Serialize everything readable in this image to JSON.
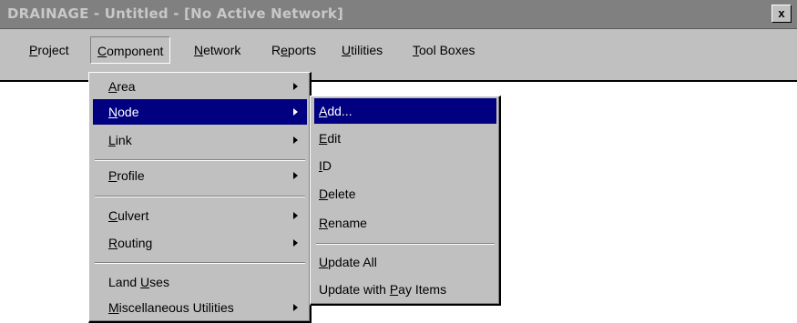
{
  "window": {
    "title": "DRAINAGE - Untitled - [No Active Network]",
    "close_glyph": "x"
  },
  "menubar": {
    "items": [
      {
        "pre": "",
        "key": "P",
        "post": "roject"
      },
      {
        "pre": "",
        "key": "C",
        "post": "omponent"
      },
      {
        "pre": "",
        "key": "N",
        "post": "etwork"
      },
      {
        "pre": "R",
        "key": "e",
        "post": "ports"
      },
      {
        "pre": "",
        "key": "U",
        "post": "tilities"
      },
      {
        "pre": "",
        "key": "T",
        "post": "ool Boxes"
      }
    ],
    "active_index": 1
  },
  "component_menu": {
    "items": [
      {
        "pre": "",
        "key": "A",
        "post": "rea",
        "submenu": true
      },
      {
        "pre": "",
        "key": "N",
        "post": "ode",
        "submenu": true,
        "selected": true
      },
      {
        "pre": "",
        "key": "L",
        "post": "ink",
        "submenu": true
      },
      {
        "pre": "",
        "key": "P",
        "post": "rofile",
        "submenu": true
      },
      {
        "pre": "",
        "key": "C",
        "post": "ulvert",
        "submenu": true
      },
      {
        "pre": "",
        "key": "R",
        "post": "outing",
        "submenu": true
      },
      {
        "pre": "Land ",
        "key": "U",
        "post": "ses",
        "submenu": false
      },
      {
        "pre": "",
        "key": "M",
        "post": "iscellaneous Utilities",
        "submenu": true
      }
    ]
  },
  "node_submenu": {
    "items": [
      {
        "pre": "",
        "key": "A",
        "post": "dd...",
        "selected": true
      },
      {
        "pre": "",
        "key": "E",
        "post": "dit"
      },
      {
        "pre": "",
        "key": "I",
        "post": "D"
      },
      {
        "pre": "",
        "key": "D",
        "post": "elete"
      },
      {
        "pre": "",
        "key": "R",
        "post": "ename"
      },
      {
        "pre": "",
        "key": "U",
        "post": "pdate All"
      },
      {
        "pre": "Update with ",
        "key": "P",
        "post": "ay Items"
      }
    ]
  },
  "colors": {
    "titlebar_bg": "#808080",
    "menu_bg": "#c0c0c0",
    "highlight": "#000080"
  }
}
